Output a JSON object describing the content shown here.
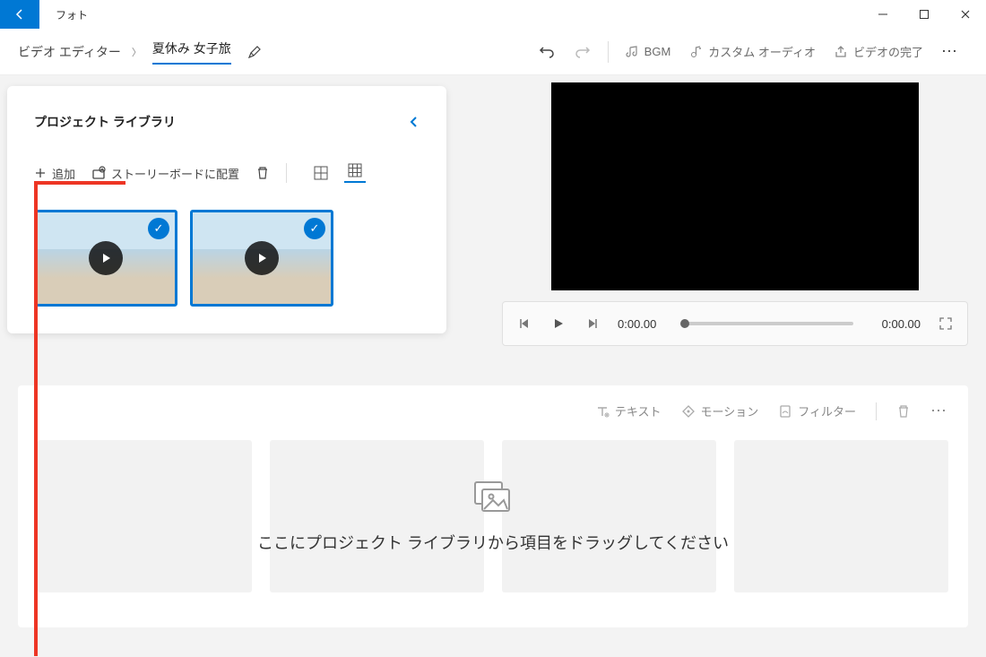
{
  "app": {
    "title": "フォト"
  },
  "breadcrumb": {
    "root": "ビデオ エディター",
    "project": "夏休み 女子旅"
  },
  "header": {
    "bgm": "BGM",
    "customAudio": "カスタム オーディオ",
    "finish": "ビデオの完了"
  },
  "library": {
    "title": "プロジェクト ライブラリ",
    "add": "追加",
    "place": "ストーリーボードに配置"
  },
  "player": {
    "current": "0:00.00",
    "total": "0:00.00"
  },
  "storyboard": {
    "text": "テキスト",
    "motion": "モーション",
    "filter": "フィルター",
    "message": "ここにプロジェクト ライブラリから項目をドラッグしてください"
  }
}
